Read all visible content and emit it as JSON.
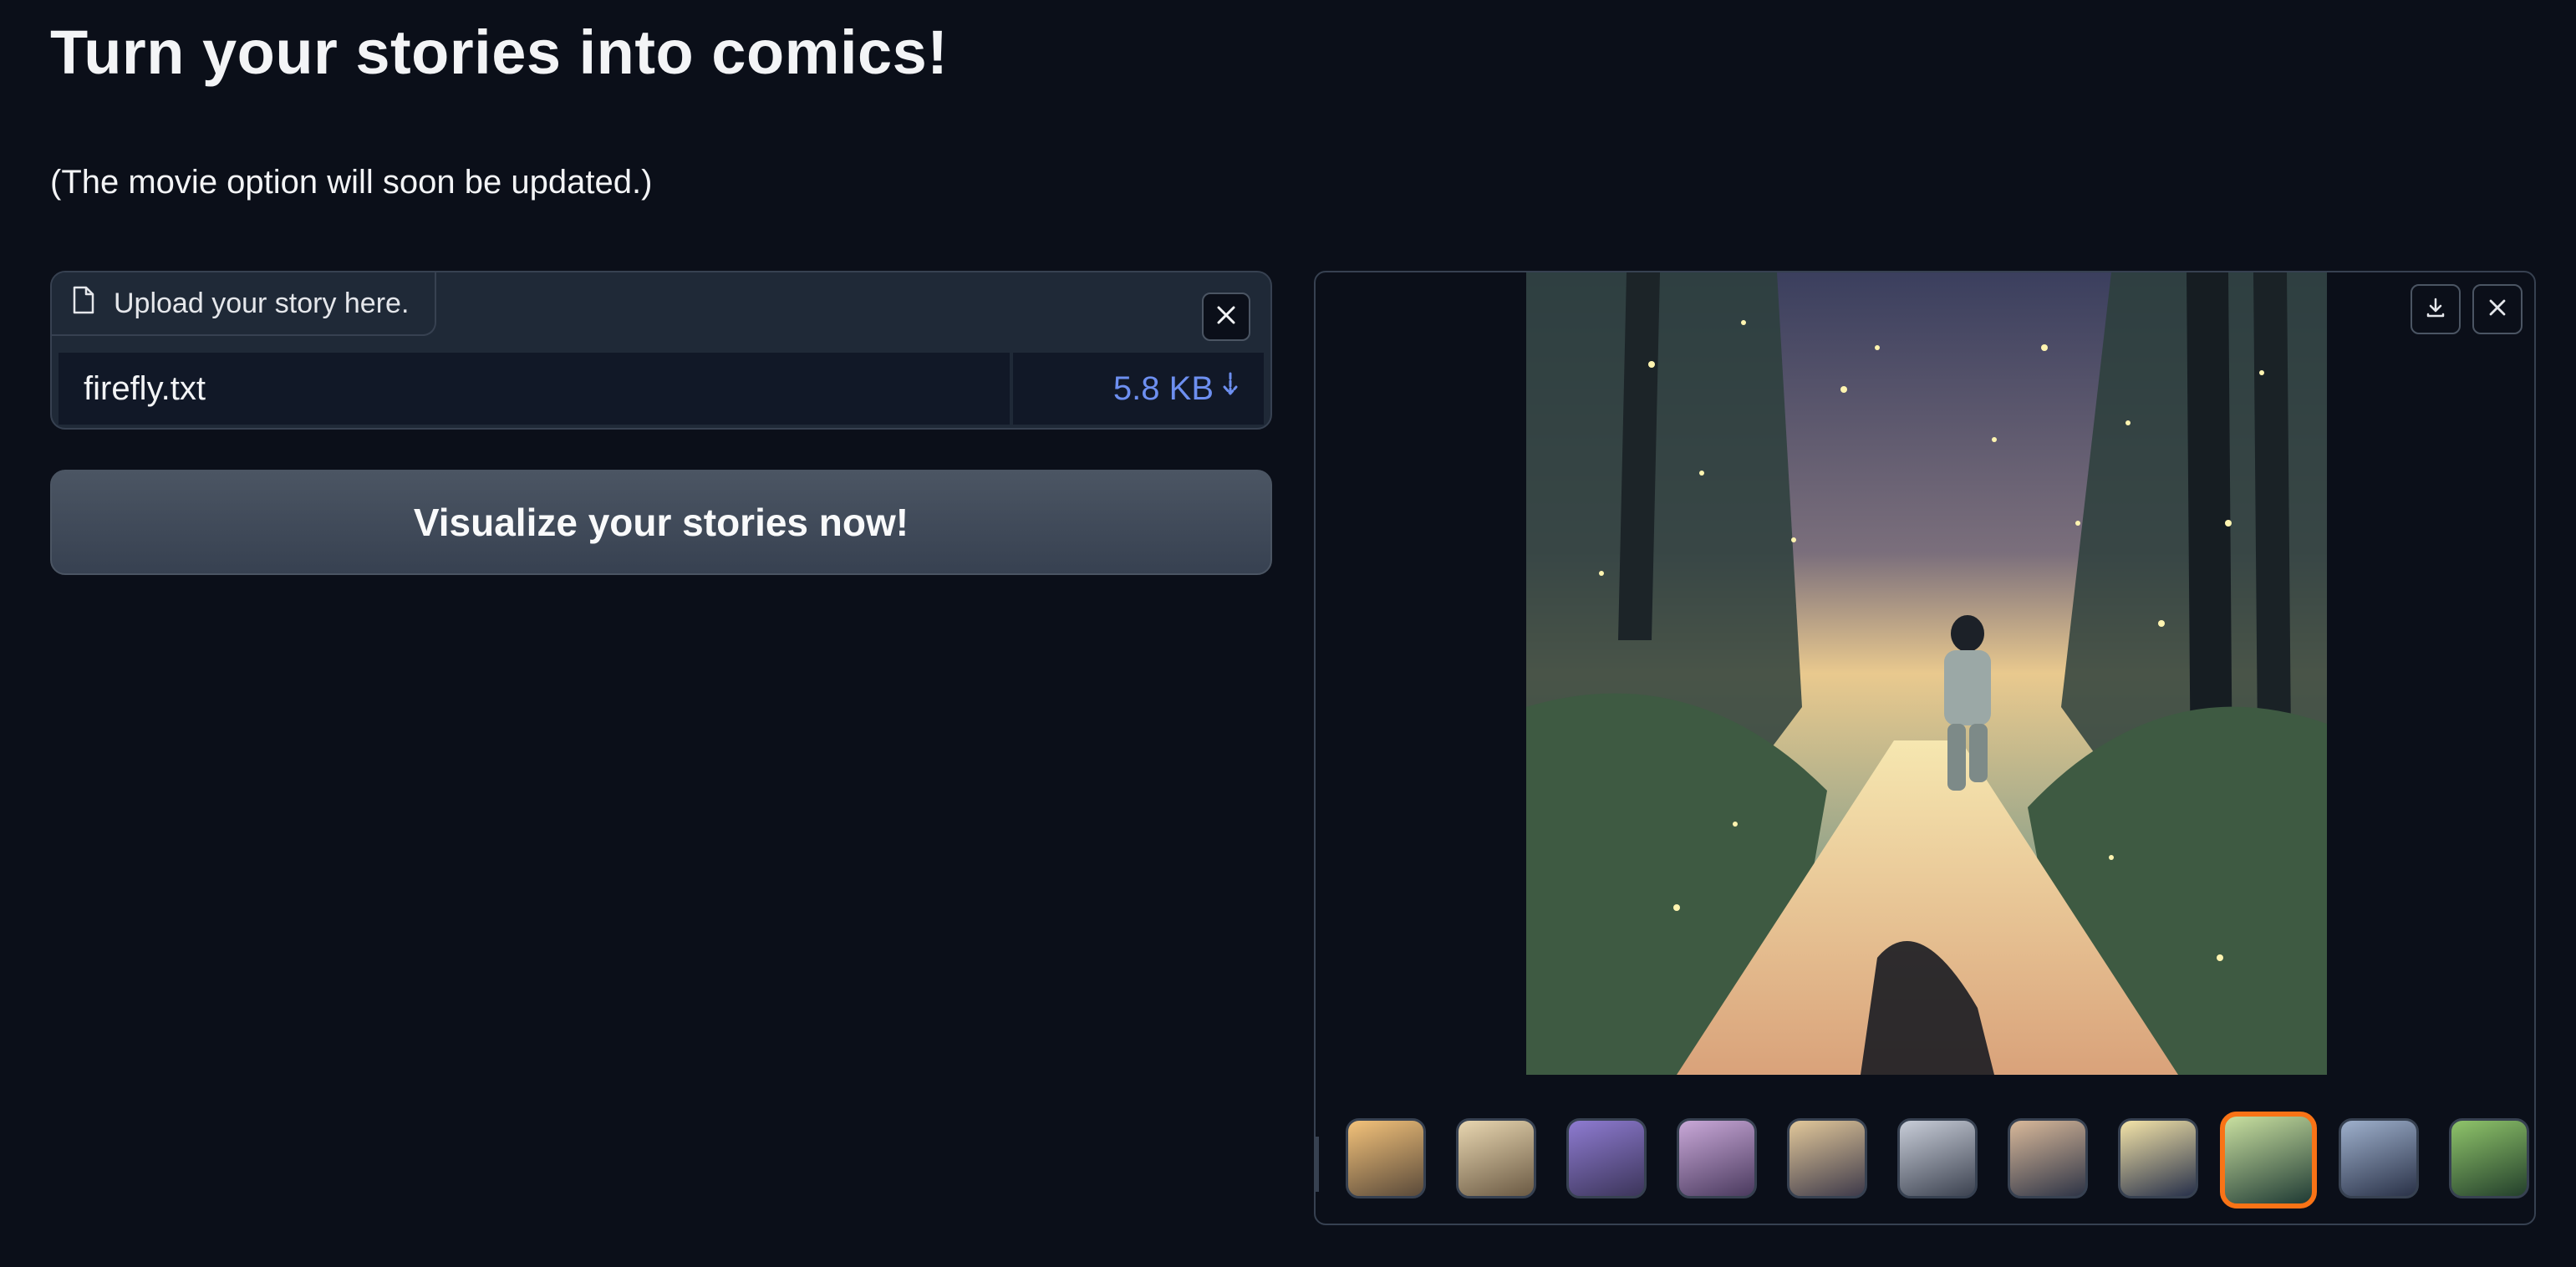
{
  "header": {
    "title": "Turn your stories into comics!",
    "subtitle": "(The movie option will soon be updated.)"
  },
  "upload": {
    "label": "Upload your story here.",
    "file_name": "firefly.txt",
    "file_size": "5.8 KB",
    "file_icon": "file-icon",
    "clear_icon": "close-icon",
    "download_icon": "download-arrow-icon"
  },
  "action": {
    "visualize_label": "Visualize your stories now!"
  },
  "gallery": {
    "download_icon": "download-icon",
    "close_icon": "close-icon",
    "selected_index": 8,
    "thumbnails": [
      {
        "name": "thumbnail-1",
        "colors": [
          "#f3c27a",
          "#5a4a3a"
        ]
      },
      {
        "name": "thumbnail-2",
        "colors": [
          "#e8d6b0",
          "#6b5a44"
        ]
      },
      {
        "name": "thumbnail-3",
        "colors": [
          "#8e7bd1",
          "#3c355a"
        ]
      },
      {
        "name": "thumbnail-4",
        "colors": [
          "#c9a8d8",
          "#4a3a5e"
        ]
      },
      {
        "name": "thumbnail-5",
        "colors": [
          "#e2c89a",
          "#3e3a4a"
        ]
      },
      {
        "name": "thumbnail-6",
        "colors": [
          "#c8cdd8",
          "#3c4250"
        ]
      },
      {
        "name": "thumbnail-7",
        "colors": [
          "#d9b99a",
          "#2e3446"
        ]
      },
      {
        "name": "thumbnail-8",
        "colors": [
          "#f4e4a8",
          "#27304a"
        ]
      },
      {
        "name": "thumbnail-9",
        "colors": [
          "#c9e0a0",
          "#1f3a34"
        ]
      },
      {
        "name": "thumbnail-10",
        "colors": [
          "#9eb0cc",
          "#2a3248"
        ]
      },
      {
        "name": "thumbnail-11",
        "colors": [
          "#8fc46a",
          "#24402c"
        ]
      }
    ]
  },
  "colors": {
    "background": "#0b0f19",
    "panel": "#1f2937",
    "border": "#374151",
    "file_size_accent": "#6d8ff0",
    "selected_thumb": "#f97316"
  }
}
